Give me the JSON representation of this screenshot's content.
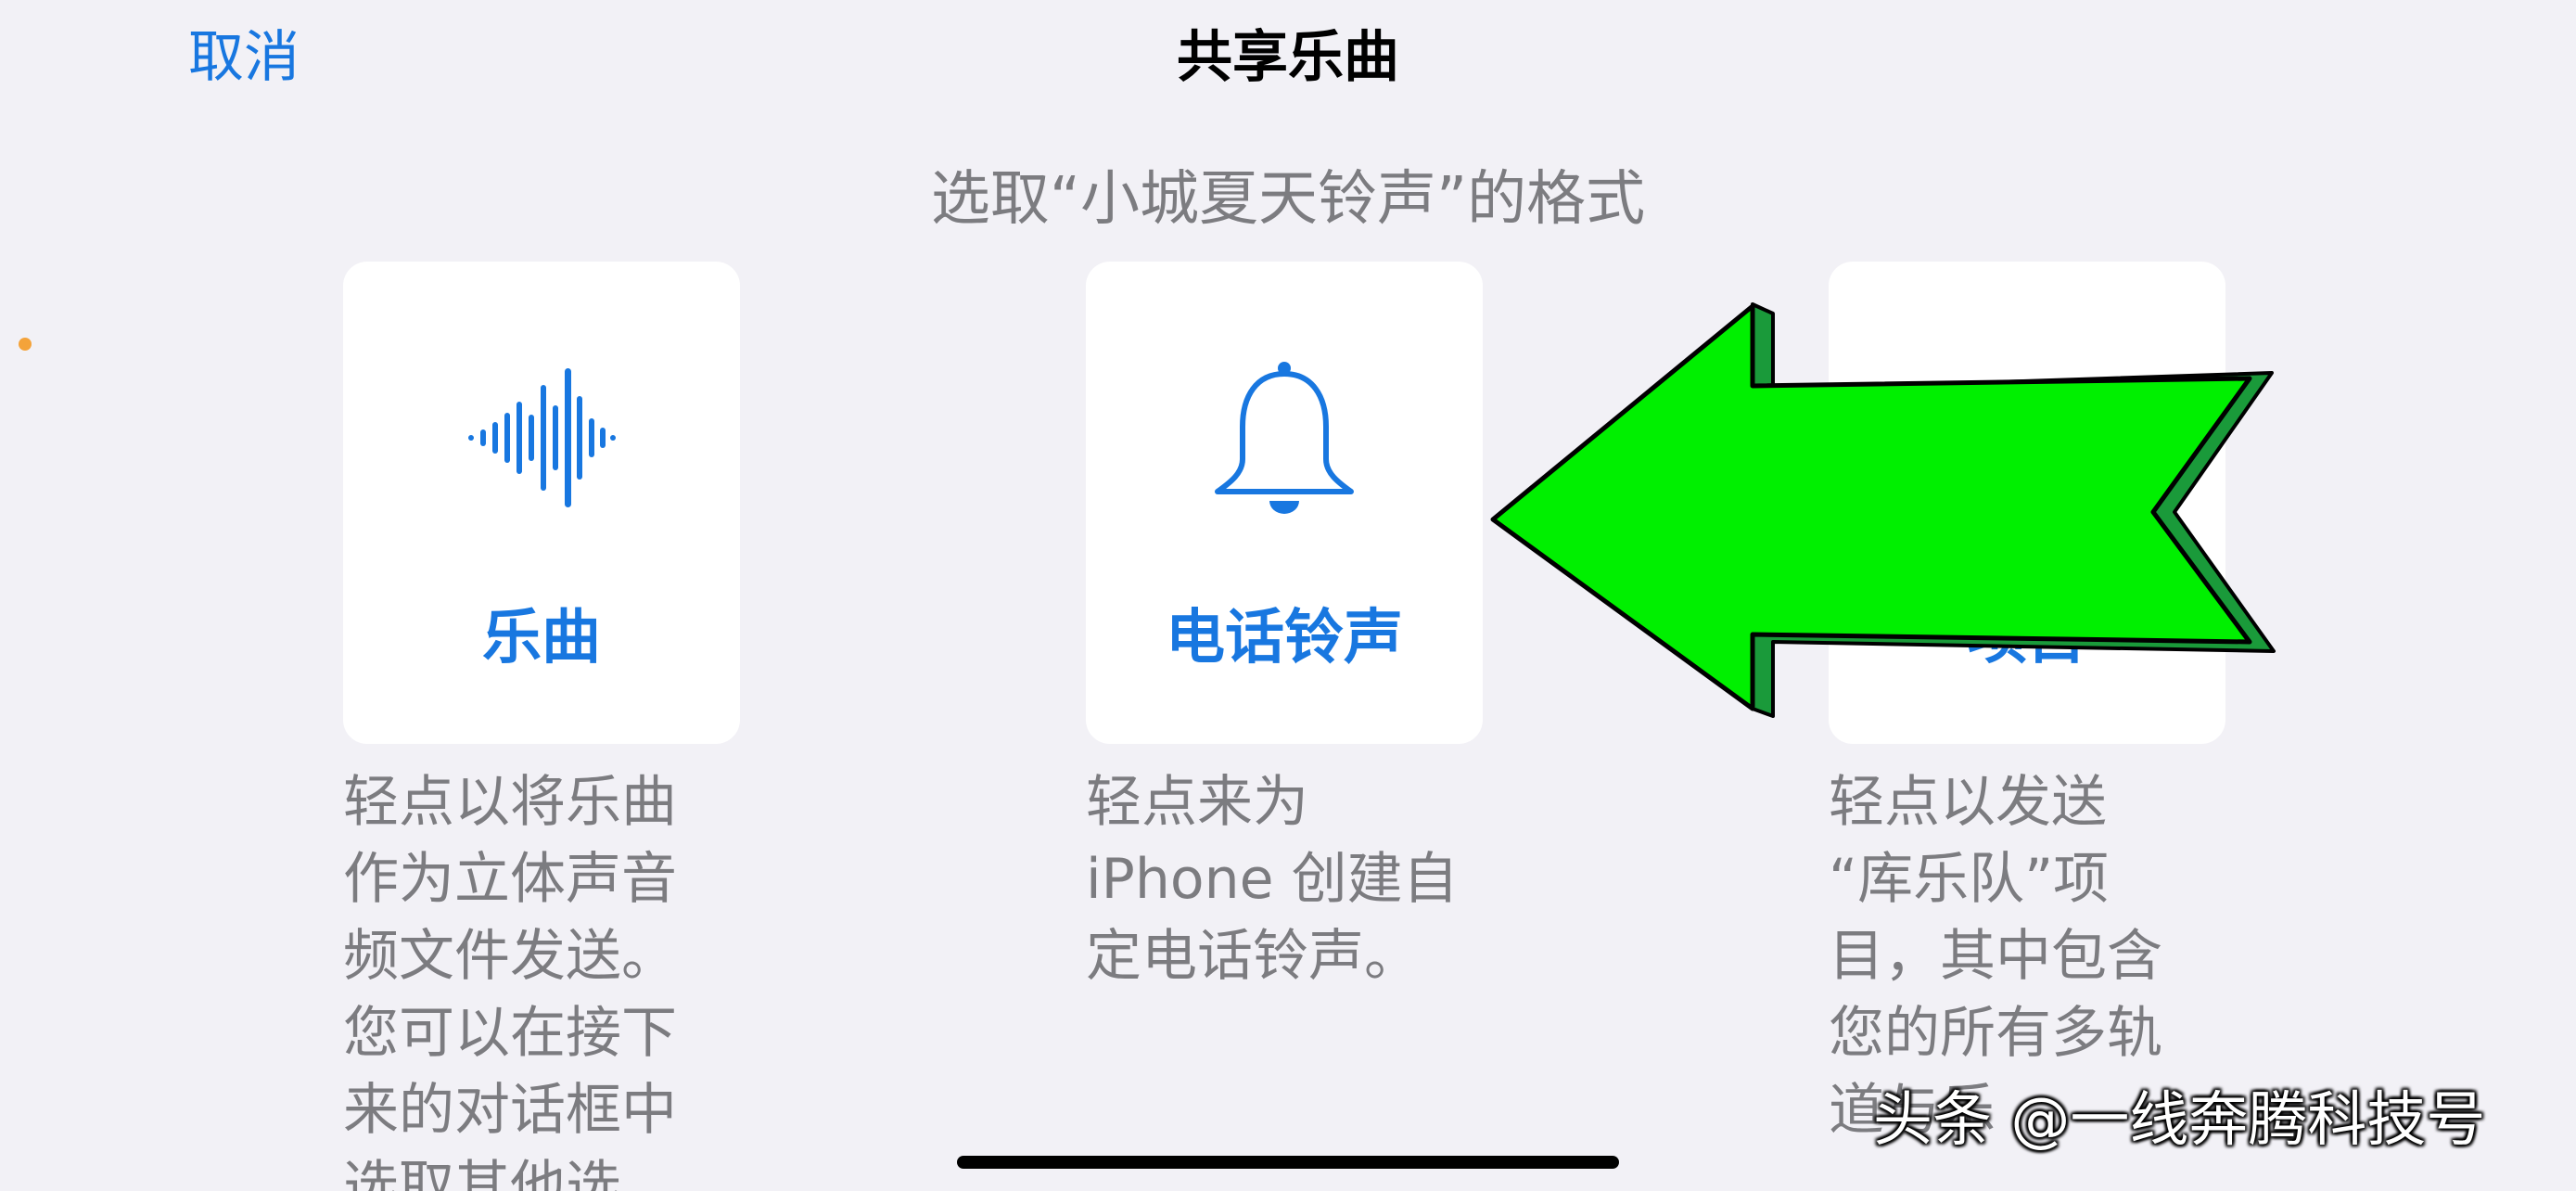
{
  "nav": {
    "cancel_label": "取消",
    "title": "共享乐曲"
  },
  "subtitle": "选取“小城夏天铃声”的格式",
  "options": [
    {
      "icon": "waveform-icon",
      "label": "乐曲",
      "description_lines": [
        "轻点以将乐曲",
        "作为立体声音",
        "频文件发送。",
        "您可以在接下",
        "来的对话框中",
        "选取其他选"
      ]
    },
    {
      "icon": "bell-icon",
      "label": "电话铃声",
      "description_lines": [
        "轻点来为",
        "iPhone 创建自",
        "定电话铃声。"
      ]
    },
    {
      "icon": "",
      "label": "项目",
      "description_lines": [
        "轻点以发送",
        "“库乐队”项",
        "目，其中包含",
        "您的所有多轨",
        "道与乐"
      ]
    }
  ],
  "overlay": {
    "arrow_color": "#00f000",
    "arrow_shadow_color": "#1a9a3a"
  },
  "accent_color": "#1877e0",
  "watermark": "头条 @一线奔腾科技号"
}
